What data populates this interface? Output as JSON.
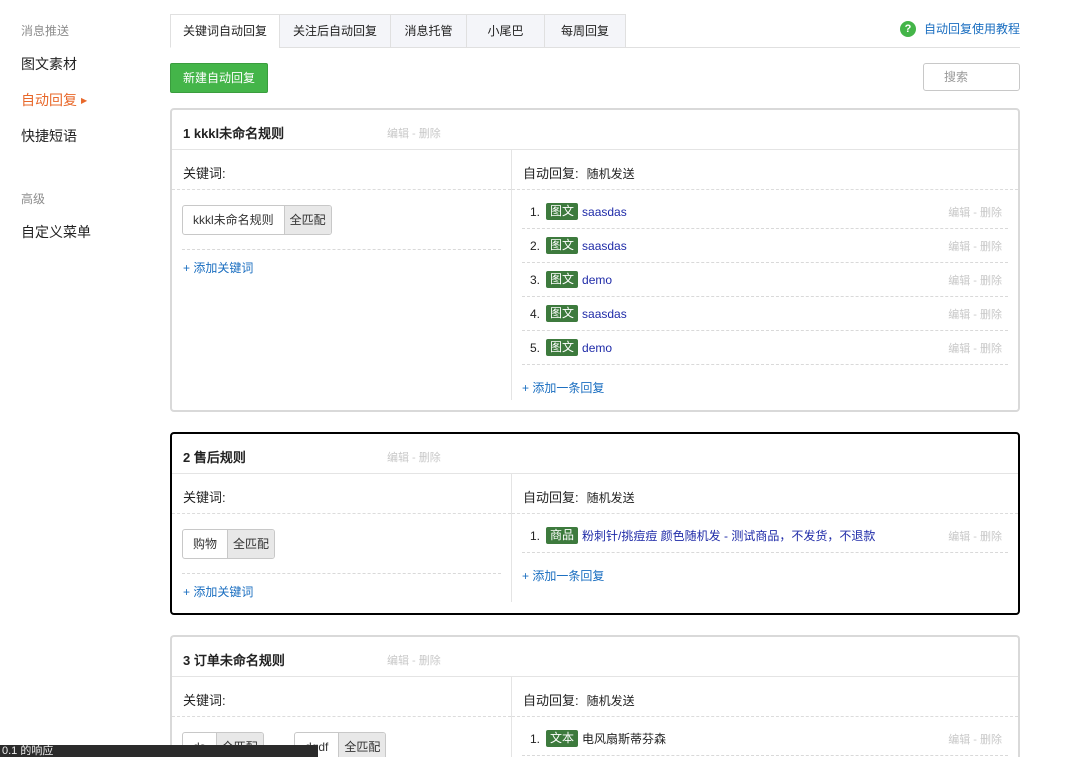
{
  "sidebar": {
    "group1_title": "消息推送",
    "items1": [
      "图文素材",
      "自动回复",
      "快捷短语"
    ],
    "group2_title": "高级",
    "items2": [
      "自定义菜单"
    ]
  },
  "tabs": [
    "关键词自动回复",
    "关注后自动回复",
    "消息托管",
    "小尾巴",
    "每周回复"
  ],
  "help": {
    "icon": "?",
    "label": "自动回复使用教程"
  },
  "new_button": "新建自动回复",
  "search": {
    "placeholder": "搜索"
  },
  "labels": {
    "keywords": "关键词:",
    "auto_reply": "自动回复:",
    "add_keyword": "+ 添加关键词",
    "add_reply": "+ 添加一条回复",
    "ops": "编辑 - 删除"
  },
  "rules": [
    {
      "title": "1 kkkl未命名规则",
      "reply_mode": "随机发送",
      "keywords": [
        {
          "text": "kkkl未命名规则",
          "mode": "全匹配"
        }
      ],
      "replies": [
        {
          "num": "1.",
          "type": "图文",
          "title": "saasdas"
        },
        {
          "num": "2.",
          "type": "图文",
          "title": "saasdas"
        },
        {
          "num": "3.",
          "type": "图文",
          "title": "demo"
        },
        {
          "num": "4.",
          "type": "图文",
          "title": "saasdas"
        },
        {
          "num": "5.",
          "type": "图文",
          "title": "demo"
        }
      ]
    },
    {
      "title": "2 售后规则",
      "reply_mode": "随机发送",
      "keywords": [
        {
          "text": "购物",
          "mode": "全匹配"
        }
      ],
      "replies": [
        {
          "num": "1.",
          "type": "商品",
          "title": "粉刺针/挑痘痘 颜色随机发 - 测试商品，不发货，不退款"
        }
      ]
    },
    {
      "title": "3 订单未命名规则",
      "reply_mode": "随机发送",
      "keywords": [
        {
          "text": "ds",
          "mode": "全匹配"
        },
        {
          "text": "dgdf",
          "mode": "全匹配"
        }
      ],
      "replies": [
        {
          "num": "1.",
          "type": "文本",
          "title": "电风扇斯蒂芬森"
        }
      ]
    }
  ],
  "status_bar": "0.1 的响应"
}
